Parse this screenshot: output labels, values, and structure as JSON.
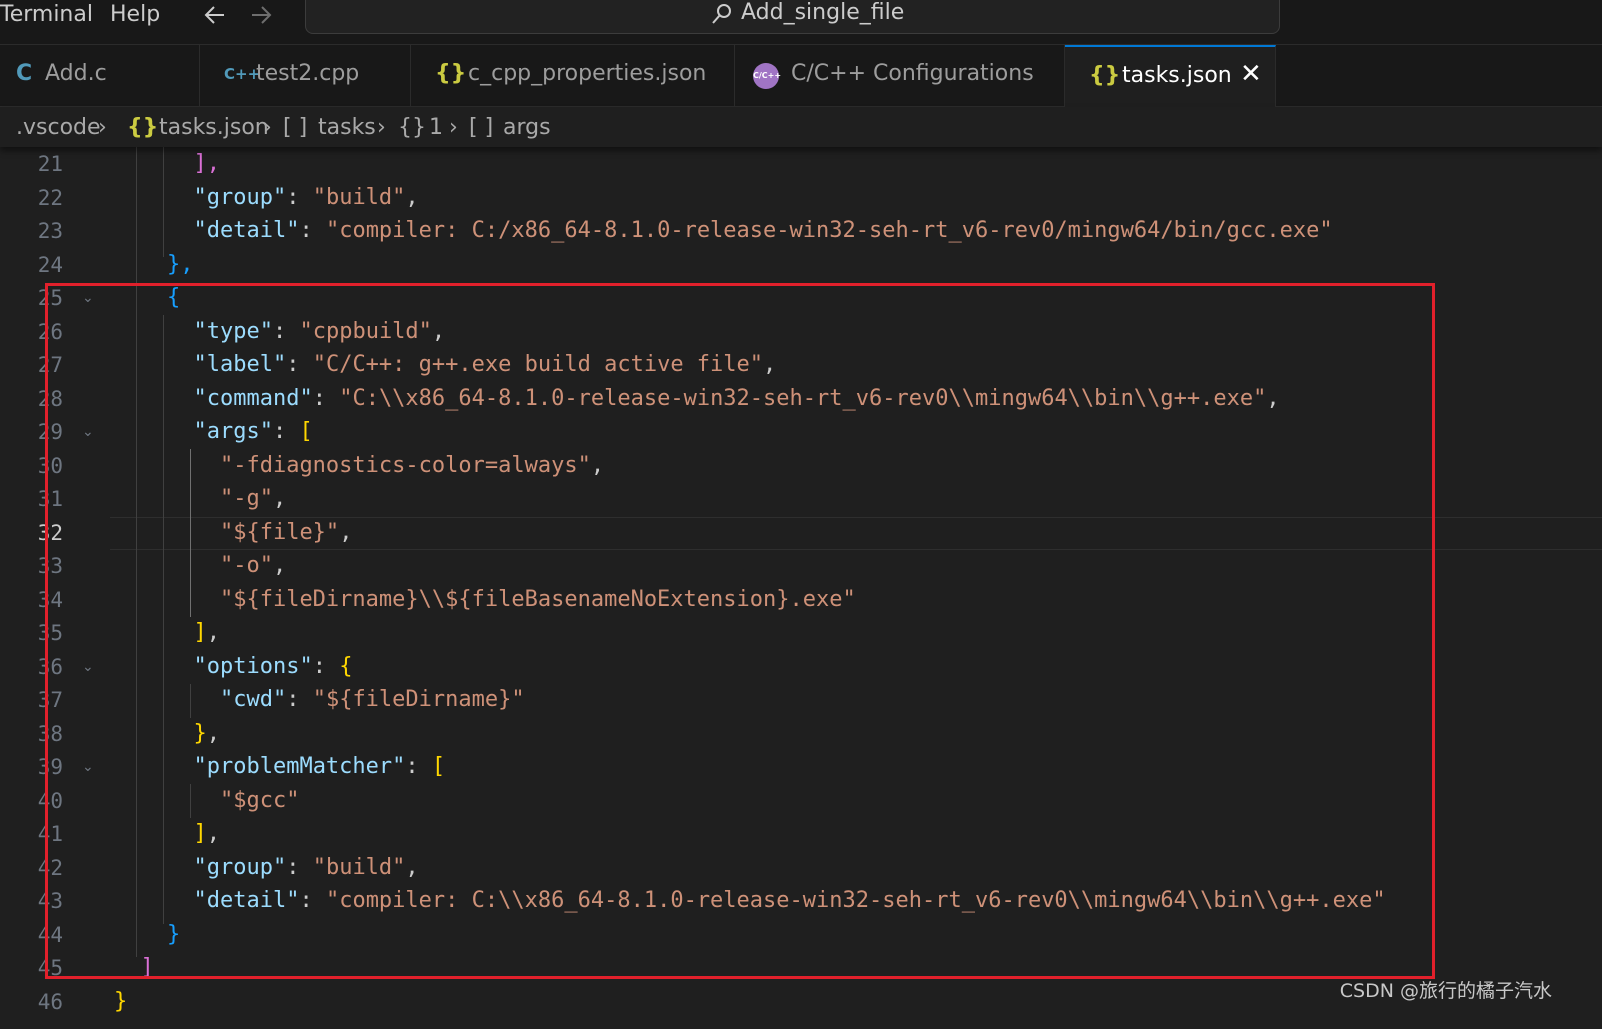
{
  "titlebar": {
    "menu": [
      "Terminal",
      "Help"
    ],
    "search_text": "Add_single_file"
  },
  "tabs": [
    {
      "icon": "C",
      "label": "Add.c",
      "icon_color": "#519aba"
    },
    {
      "icon": "C++",
      "label": "test2.cpp",
      "icon_color": "#519aba"
    },
    {
      "icon": "{}",
      "label": "c_cpp_properties.json",
      "icon_color": "#cbcb41"
    },
    {
      "icon": "C/C++",
      "label": "C/C++ Configurations",
      "icon_color": "#a074c4"
    },
    {
      "icon": "{}",
      "label": "tasks.json",
      "icon_color": "#cbcb41",
      "active": true
    }
  ],
  "breadcrumb": {
    "folder": ".vscode",
    "file_icon": "{}",
    "file": "tasks.json",
    "array_icon": "[ ]",
    "tasks": "tasks",
    "object_icon": "{}",
    "index": "1",
    "args": "args"
  },
  "editor": {
    "current_line": 32,
    "line_numbers": [
      "21",
      "22",
      "23",
      "24",
      "25",
      "26",
      "27",
      "28",
      "29",
      "30",
      "31",
      "32",
      "33",
      "34",
      "35",
      "36",
      "37",
      "38",
      "39",
      "40",
      "41",
      "42",
      "43",
      "44",
      "45",
      "46"
    ]
  },
  "code": {
    "l21": "],",
    "l22_key": "\"group\"",
    "l22_val": "\"build\"",
    "l23_key": "\"detail\"",
    "l23_val": "\"compiler: C:/x86_64-8.1.0-release-win32-seh-rt_v6-rev0/mingw64/bin/gcc.exe\"",
    "l24": "},",
    "l25": "{",
    "l26_key": "\"type\"",
    "l26_val": "\"cppbuild\"",
    "l27_key": "\"label\"",
    "l27_val": "\"C/C++: g++.exe build active file\"",
    "l28_key": "\"command\"",
    "l28_val": "\"C:\\\\x86_64-8.1.0-release-win32-seh-rt_v6-rev0\\\\mingw64\\\\bin\\\\g++.exe\"",
    "l29_key": "\"args\"",
    "l30": "\"-fdiagnostics-color=always\"",
    "l31": "\"-g\"",
    "l32": "\"${file}\"",
    "l33": "\"-o\"",
    "l34": "\"${fileDirname}\\\\${fileBasenameNoExtension}.exe\"",
    "l36_key": "\"options\"",
    "l37_key": "\"cwd\"",
    "l37_val": "\"${fileDirname}\"",
    "l39_key": "\"problemMatcher\"",
    "l40": "\"$gcc\"",
    "l42_key": "\"group\"",
    "l42_val": "\"build\"",
    "l43_key": "\"detail\"",
    "l43_val": "\"compiler: C:\\\\x86_64-8.1.0-release-win32-seh-rt_v6-rev0\\\\mingw64\\\\bin\\\\g++.exe\""
  },
  "colors": {
    "annotation_box": "#e1202b",
    "key": "#9cdcfe",
    "string": "#ce9178"
  },
  "watermark": "CSDN @旅行的橘子汽水"
}
